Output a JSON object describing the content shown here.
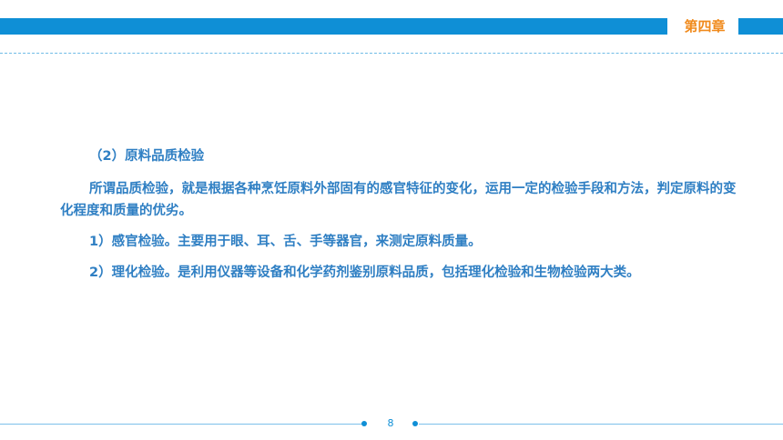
{
  "header": {
    "chapter": "第四章"
  },
  "content": {
    "heading": "（2）原料品质检验",
    "paragraphs": [
      "所谓品质检验，就是根据各种烹饪原料外部固有的感官特征的变化，运用一定的检验手段和方法，判定原料的变化程度和质量的优劣。",
      "1）感官检验。主要用于眼、耳、舌、手等器官，来测定原料质量。",
      "2）理化检验。是利用仪器等设备和化学药剂鉴别原料品质，包括理化检验和生物检验两大类。"
    ]
  },
  "footer": {
    "page_number": "8"
  },
  "colors": {
    "accent_blue": "#0f8fd6",
    "chapter_orange": "#f08a1c",
    "text_blue": "#2f7fc3"
  }
}
